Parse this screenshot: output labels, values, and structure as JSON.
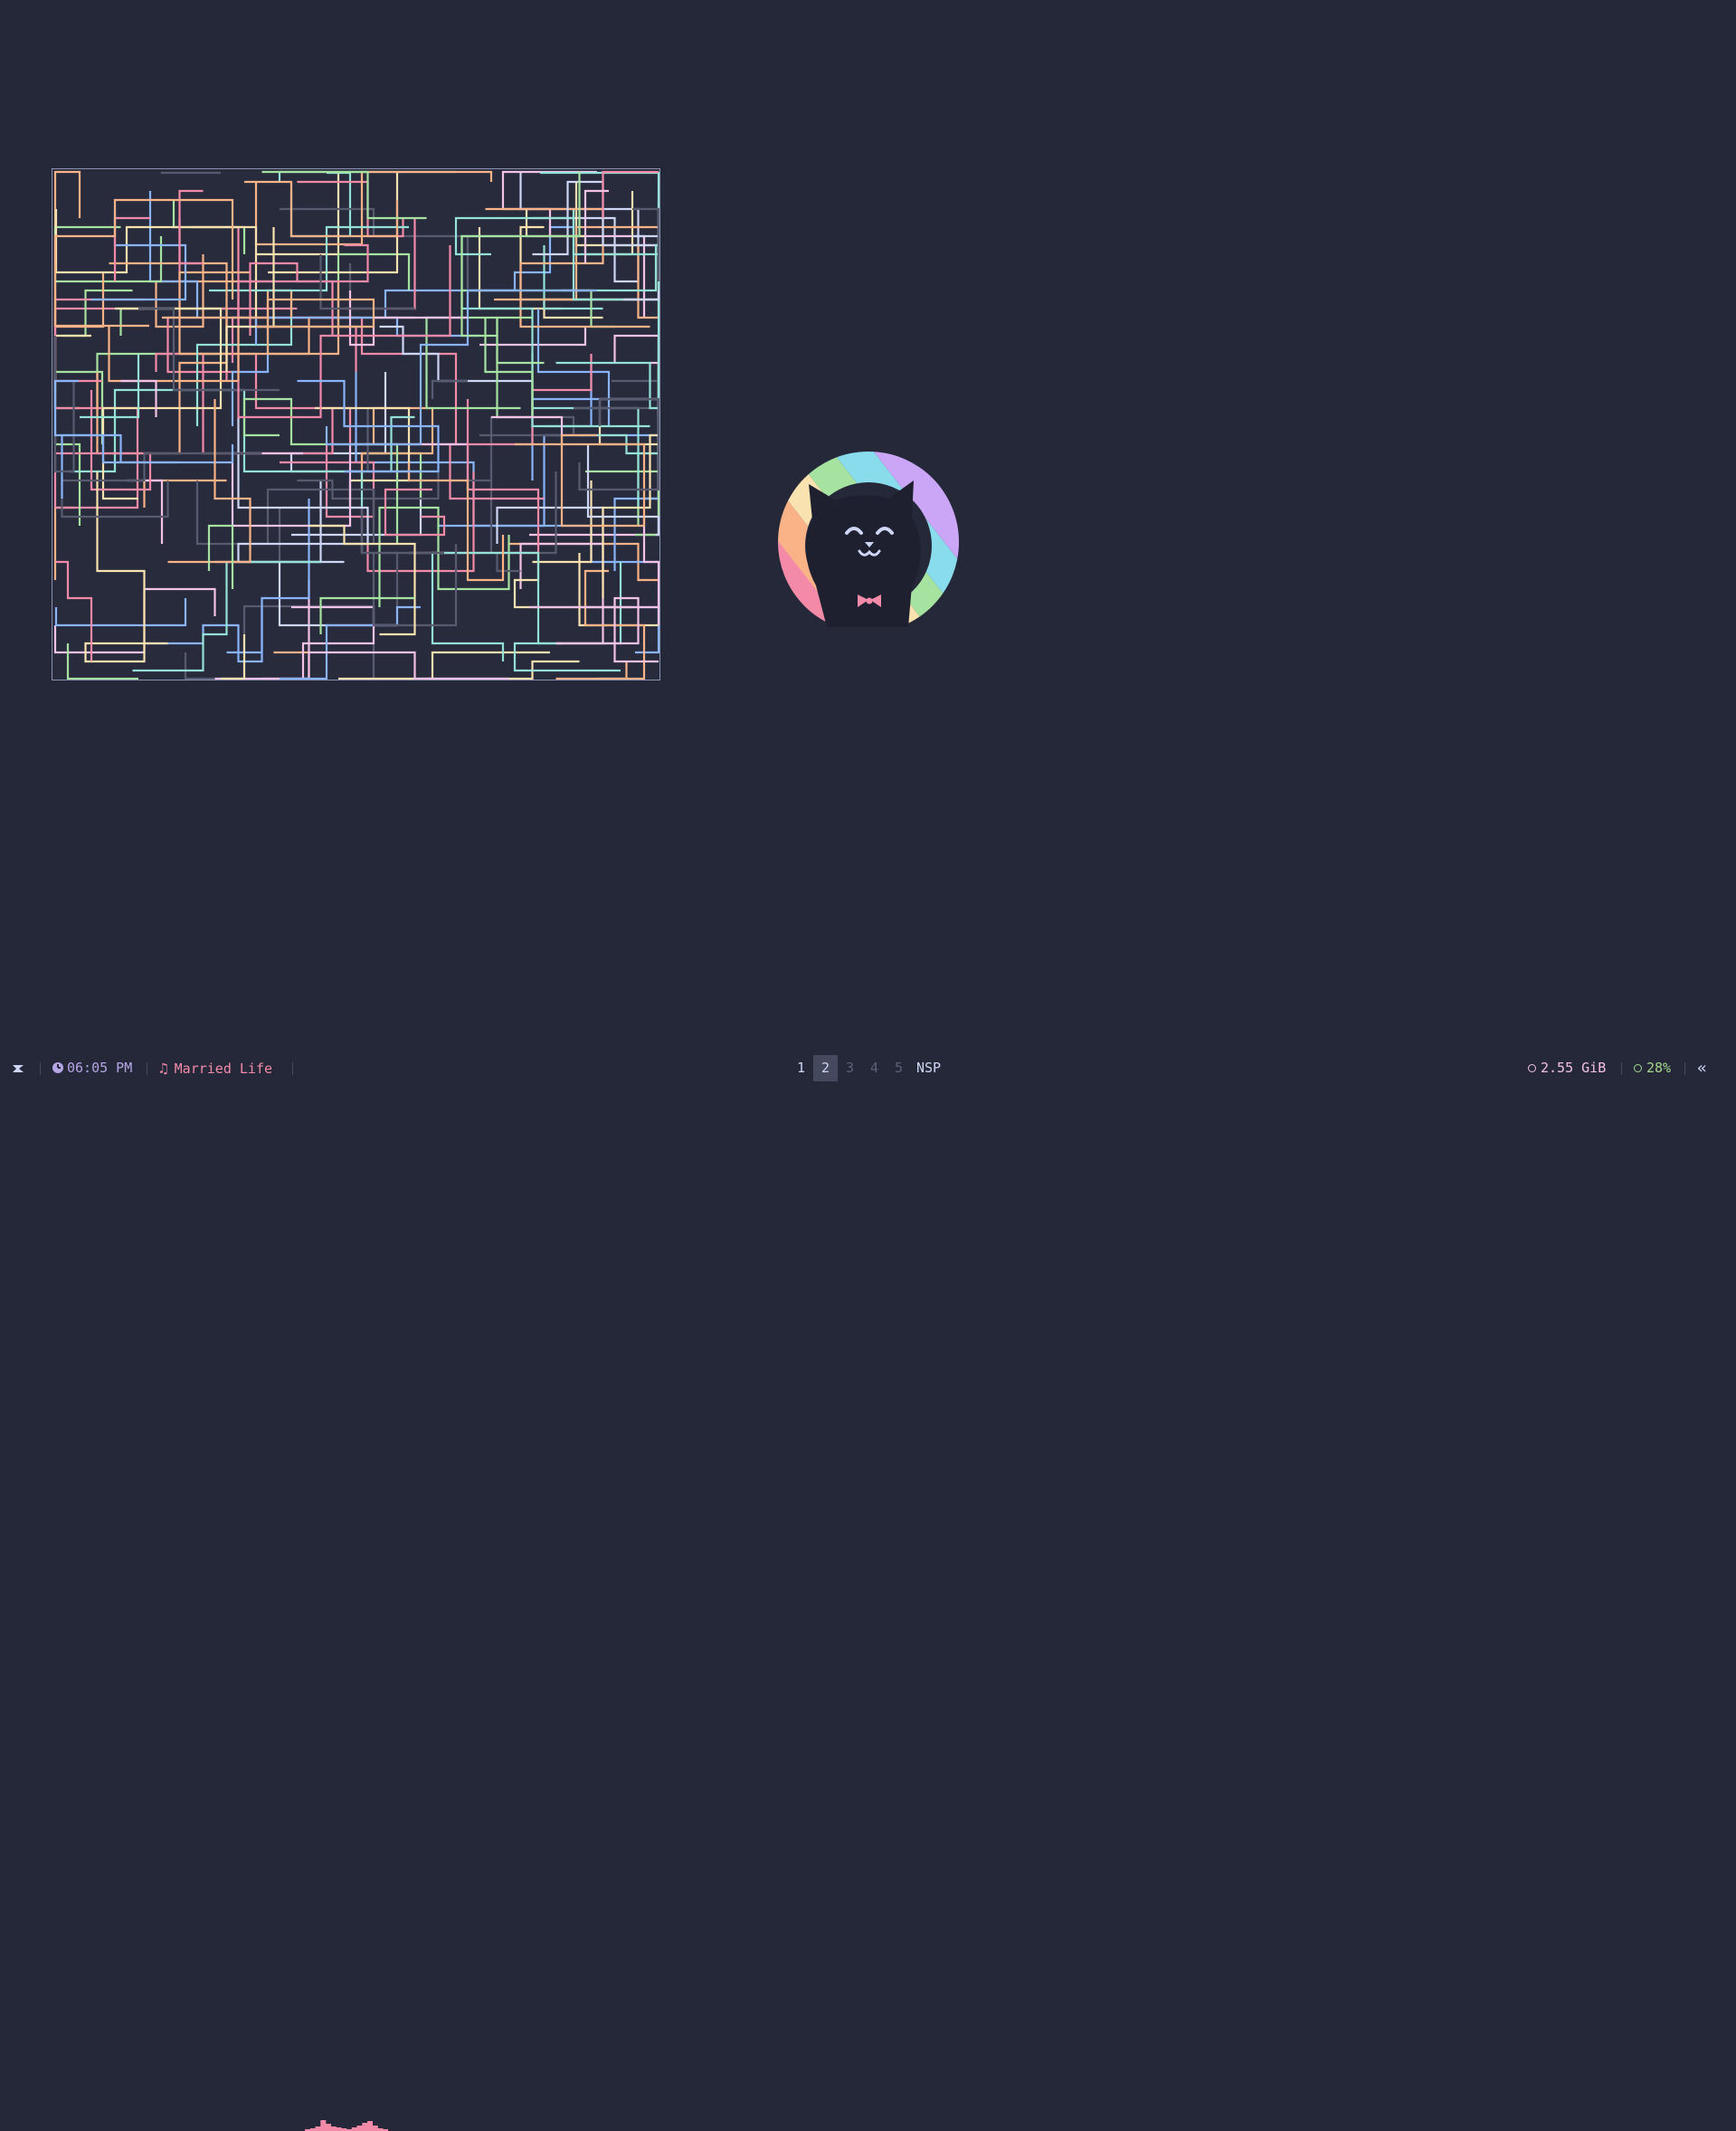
{
  "desktop": {
    "background": "#242839"
  },
  "pipes_window": {
    "border_color": "#8b93b3",
    "background": "#272b3c"
  },
  "logo": {
    "icon": "catppuccin-cat-logo",
    "ring_colors": [
      "#f38ba8",
      "#fab387",
      "#f9e2af",
      "#a6e3a1",
      "#89dceb",
      "#cba6f7"
    ]
  },
  "bar": {
    "launcher_icon": "arch-launcher-icon",
    "clock": {
      "icon": "clock-icon",
      "time": "06:05 PM"
    },
    "music": {
      "icon": "music-note-icon",
      "note_glyph": "♫",
      "title": "Married Life"
    },
    "visualizer": {
      "icon": "audio-visualizer-icon",
      "color": "#f38ba8"
    },
    "workspaces": [
      {
        "label": "1",
        "state": "occupied"
      },
      {
        "label": "2",
        "state": "active"
      },
      {
        "label": "3",
        "state": "empty"
      },
      {
        "label": "4",
        "state": "empty"
      },
      {
        "label": "5",
        "state": "empty"
      }
    ],
    "scratchpad_label": "NSP",
    "memory": {
      "icon": "memory-icon",
      "value": "2.55 GiB"
    },
    "battery": {
      "icon": "battery-icon",
      "value": "28%"
    },
    "collapse_glyph": "«",
    "collapse_icon": "double-chevron-left-icon"
  }
}
